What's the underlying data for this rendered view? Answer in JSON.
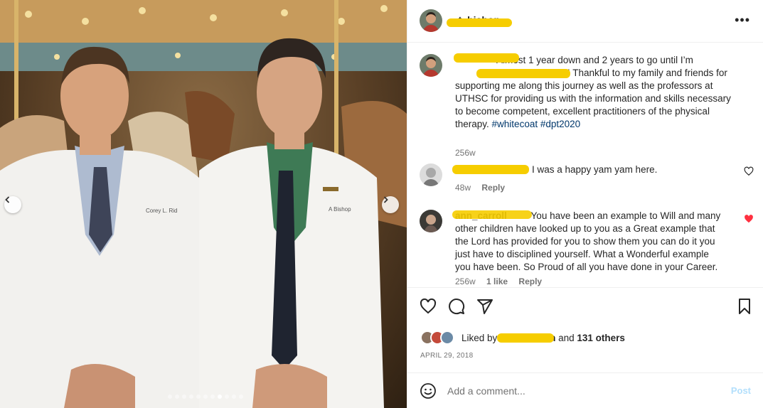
{
  "post": {
    "username": "...t_bishop",
    "caption_user": "",
    "caption": "Almost 1 year down and 2 years to go until I’m ... Thankful to my family and friends for supporting me along this journey as well as the professors at UTHSC for providing us with the information and skills necessary to become competent, excellent practitioners of the physical therapy.",
    "caption_line1": "Almost 1 year down and 2 years to go until I’m",
    "caption_line2_tail": "! Thankful to my family and friends for",
    "caption_line3": "supporting me along this journey as well as the professors at",
    "caption_line4": "UTHSC for providing us with the information and skills necessary",
    "caption_line5": "to become competent, excellent practitioners of the physical",
    "caption_line6": "therapy.",
    "hashtags": "#whitecoat #dpt2020",
    "caption_time": "256w"
  },
  "photo": {
    "coat_text_left": "Corey L. Rid",
    "coat_text_right": "A Bishop"
  },
  "comments": [
    {
      "text": "I was a happy yam yam here.",
      "time": "48w",
      "reply_label": "Reply",
      "liked": false
    },
    {
      "username": "ann_carroll",
      "text_line1": "You have been an example to Will and many",
      "text_line2": "other children have looked up to you as a Great example that",
      "text_line3": "the Lord has provided for you to show them you can do it you",
      "text_line4": "just have to disciplined yourself. What a Wonderful example",
      "text_line5": "you have been. So Proud of all you have done in your Career.",
      "time": "256w",
      "likes": "1 like",
      "reply_label": "Reply",
      "liked": true
    }
  ],
  "likes": {
    "prefix": "Liked by",
    "suffix_name_tail": "h",
    "and": "and",
    "others": "131 others"
  },
  "date": "APRIL 29, 2018",
  "add_comment": {
    "placeholder": "Add a comment...",
    "post_label": "Post"
  },
  "colors": {
    "redaction": "#f6cd00",
    "heart_liked": "#ff3040",
    "hashtag": "#00376b",
    "post_button": "#b2dffc"
  },
  "icons": [
    "chevron-left-icon",
    "chevron-right-icon",
    "more-options-icon",
    "heart-icon",
    "comment-icon",
    "share-icon",
    "bookmark-icon",
    "emoji-icon"
  ]
}
